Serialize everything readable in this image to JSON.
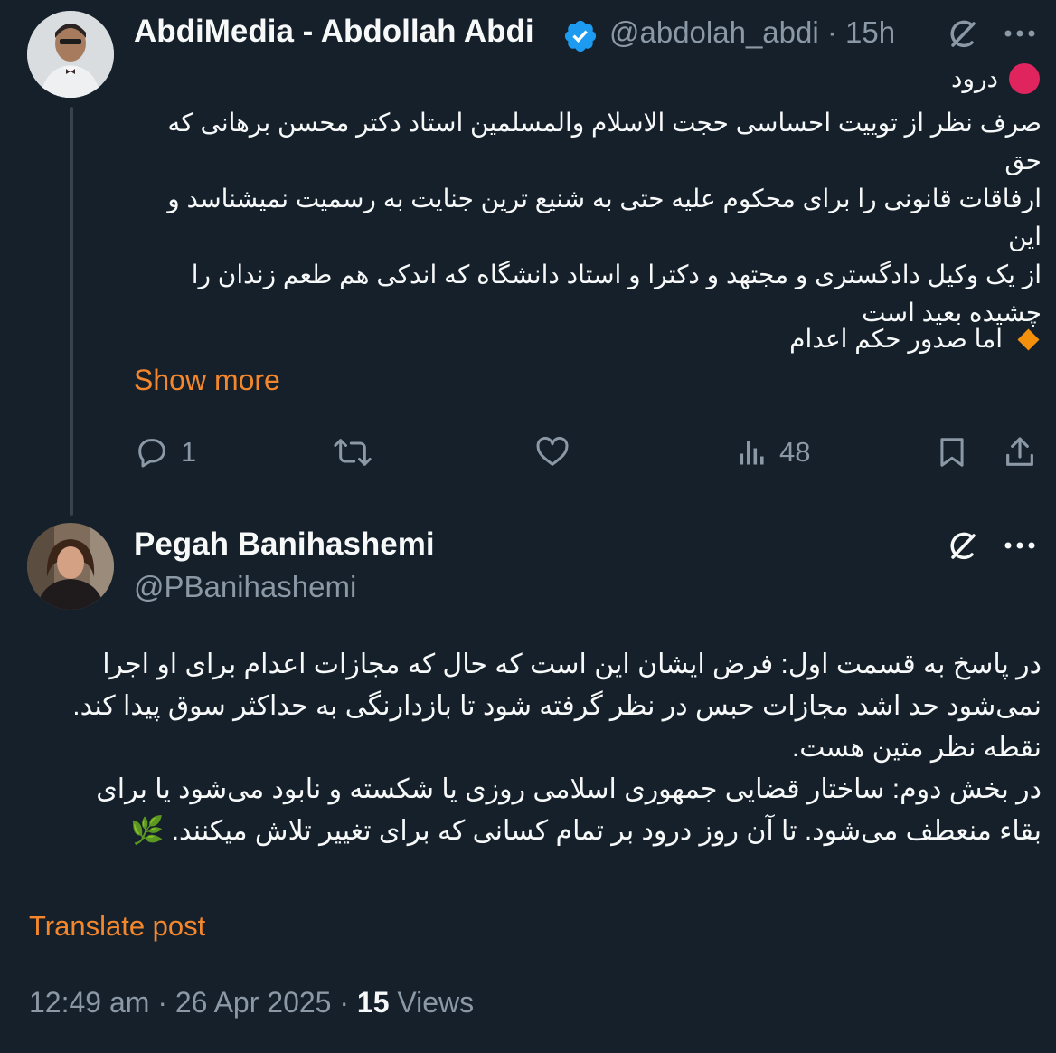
{
  "tweet1": {
    "display_name": "AbdiMedia - Abdollah Abdi",
    "handle": "@abdolah_abdi",
    "separator": "·",
    "time": "15h",
    "greeting": "درود",
    "paragraph_lines": [
      "صرف نظر از توییت احساسی حجت الاسلام والمسلمین استاد دکتر محسن برهانی که حق",
      "ارفاقات قانونی را برای محکوم علیه حتی به شنیع ترین جنایت به رسمیت نمیشناسد و این",
      "از یک وکیل دادگستری و مجتهد و دکترا و استاد دانشگاه که اندکی هم طعم زندان را",
      "چشیده بعید است"
    ],
    "bullet_text": "اما صدور حکم اعدام",
    "show_more": "Show more",
    "actions": {
      "replies": "1",
      "views": "48"
    }
  },
  "tweet2": {
    "display_name": "Pegah Banihashemi",
    "handle": "@PBanihashemi",
    "text_lines": [
      "در پاسخ به قسمت اول: فرض ایشان این است که حال که مجازات اعدام برای او اجرا",
      "نمی‌شود حد اشد مجازات حبس در نظر گرفته شود تا بازدارنگی به حداکثر سوق پیدا کند.",
      "نقطه نظر متین هست.",
      "در بخش دوم: ساختار قضایی جمهوری اسلامی روزی یا شکسته و نابود می‌شود یا برای",
      "بقاء منعطف می‌شود. تا آن روز درود بر تمام کسانی که برای تغییر تلاش میکنند. 🌿"
    ],
    "translate": "Translate post",
    "timestamp": "12:49 am · 26 Apr 2025 · ",
    "views_count": "15",
    "views_label": " Views"
  },
  "colors": {
    "background": "#15202b",
    "text": "#f7f9f9",
    "muted": "#8b98a5",
    "accent_orange": "#f4872b",
    "verified_blue": "#1d9bf0",
    "red_circle": "#e0245e"
  },
  "icons": [
    "verified-badge-icon",
    "grok-icon",
    "more-icon",
    "red-circle-icon",
    "orange-diamond-icon",
    "reply-icon",
    "retweet-icon",
    "like-icon",
    "views-icon",
    "bookmark-icon",
    "share-icon"
  ]
}
